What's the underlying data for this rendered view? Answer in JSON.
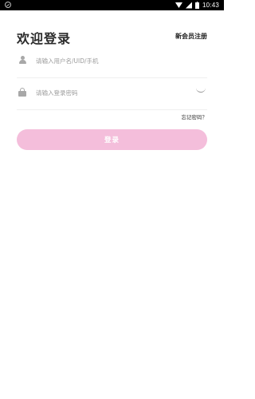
{
  "status_bar": {
    "time": "10:43",
    "icons": [
      "sync-icon",
      "wifi-icon",
      "signal-icon",
      "battery-icon"
    ]
  },
  "header": {
    "title": "欢迎登录",
    "register_link": "新会员注册"
  },
  "form": {
    "username": {
      "placeholder": "请输入用户名/UID/手机",
      "icon": "user-icon"
    },
    "password": {
      "placeholder": "请输入登录密码",
      "icon": "lock-icon",
      "toggle_icon": "eye-closed-icon"
    },
    "forgot_link": "忘记密码？",
    "login_button": "登录"
  },
  "colors": {
    "button_bg": "#f4bedb",
    "button_text": "#ffffff",
    "title_text": "#2b2b2b",
    "placeholder_text": "#9b9b9b",
    "divider": "#efefef",
    "status_bar_bg": "#000000"
  }
}
